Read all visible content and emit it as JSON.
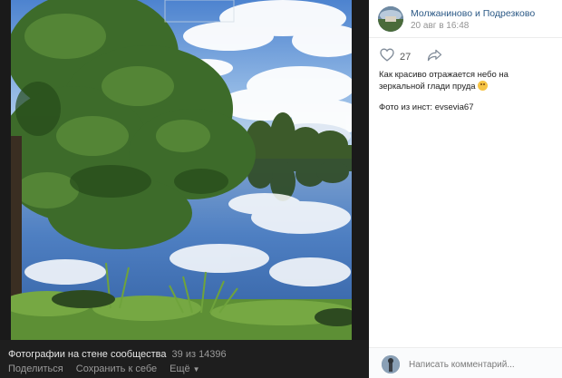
{
  "viewer": {
    "album_title": "Фотографии на стене сообщества",
    "counter": "39 из 14396",
    "share_label": "Поделиться",
    "save_label": "Сохранить к себе",
    "more_label": "Ещё"
  },
  "post": {
    "group_name": "Молжаниново и Подрезково",
    "date": "20 авг в 16:48",
    "likes": "27",
    "text": "Как красиво отражается небо на зеркальной глади пруда",
    "text_emoji": "smile-emoji",
    "credit": "Фото из инст: evsevia67"
  },
  "comment": {
    "placeholder": "Написать комментарий..."
  },
  "icons": {
    "like": "heart-icon",
    "share": "share-arrow-icon",
    "more": "chevron-down-icon"
  },
  "colors": {
    "link": "#2a5885",
    "panel_bg": "#ffffff",
    "viewer_bg": "#1a1a1a"
  }
}
